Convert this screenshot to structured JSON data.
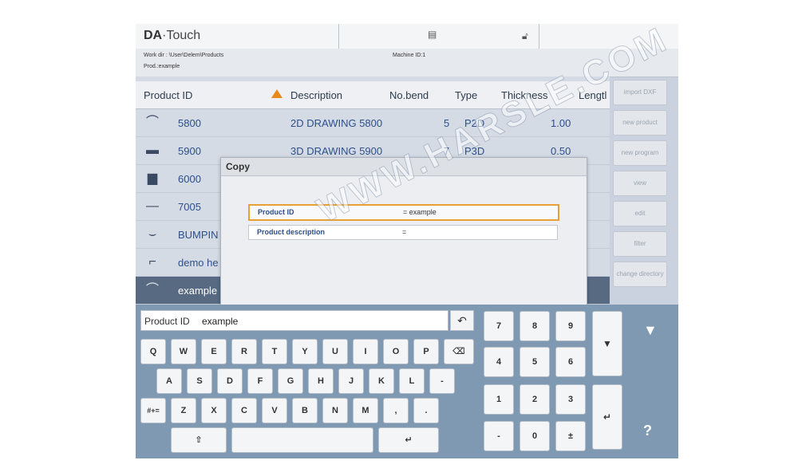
{
  "header": {
    "brand_prefix": "DA",
    "brand_suffix": "·Touch",
    "work_dir": "Work dir : \\User\\Delem\\Products",
    "prod": "Prod.:example",
    "machine_id": "Machine ID:1"
  },
  "table": {
    "columns": [
      "Product ID",
      "Description",
      "No.bend",
      "Type",
      "Thickness",
      "Lengtl"
    ],
    "rows": [
      {
        "id": "5800",
        "description": "2D DRAWING 5800",
        "bends": "5",
        "type": "P2D",
        "thickness": "1.00",
        "thumb": "bent-profile-icon"
      },
      {
        "id": "5900",
        "description": "3D DRAWING 5900",
        "bends": "7",
        "type": "P3D",
        "thickness": "0.50",
        "thumb": "3d-part-icon"
      },
      {
        "id": "6000",
        "description": "",
        "bends": "",
        "type": "",
        "thickness": "",
        "thumb": "box-part-icon"
      },
      {
        "id": "7005",
        "description": "",
        "bends": "",
        "type": "",
        "thickness": "",
        "thumb": "flat-profile-icon"
      },
      {
        "id": "BUMPIN",
        "description": "",
        "bends": "",
        "type": "",
        "thickness": "",
        "thumb": "u-profile-icon"
      },
      {
        "id": "demo he",
        "description": "",
        "bends": "",
        "type": "",
        "thickness": "",
        "thumb": "hem-profile-icon"
      },
      {
        "id": "example",
        "description": "",
        "bends": "",
        "type": "",
        "thickness": "",
        "thumb": "bent-profile-icon"
      }
    ]
  },
  "side_buttons": [
    "import DXF",
    "new product",
    "new program",
    "view",
    "edit",
    "filter",
    "change directory"
  ],
  "dialog": {
    "title": "Copy",
    "fields": [
      {
        "label": "Product ID",
        "value": "= example"
      },
      {
        "label": "Product description",
        "value": "="
      }
    ]
  },
  "keyboard": {
    "input_label": "Product ID",
    "input_value": "example",
    "row1": [
      "Q",
      "W",
      "E",
      "R",
      "T",
      "Y",
      "U",
      "I",
      "O",
      "P"
    ],
    "row2": [
      "A",
      "S",
      "D",
      "F",
      "G",
      "H",
      "J",
      "K",
      "L",
      "-"
    ],
    "row3": [
      "Z",
      "X",
      "C",
      "V",
      "B",
      "N",
      "M",
      ",",
      "."
    ],
    "symbols_key": "#+=",
    "numpad": [
      [
        "7",
        "8",
        "9"
      ],
      [
        "4",
        "5",
        "6"
      ],
      [
        "1",
        "2",
        "3"
      ],
      [
        "-",
        "0",
        "±"
      ]
    ],
    "help": "?"
  },
  "watermark": "WWW.HARSLE.COM",
  "colors": {
    "accent_orange": "#e88a1a",
    "selected_row": "#576a82",
    "keyboard_bg": "#7e99b1"
  }
}
